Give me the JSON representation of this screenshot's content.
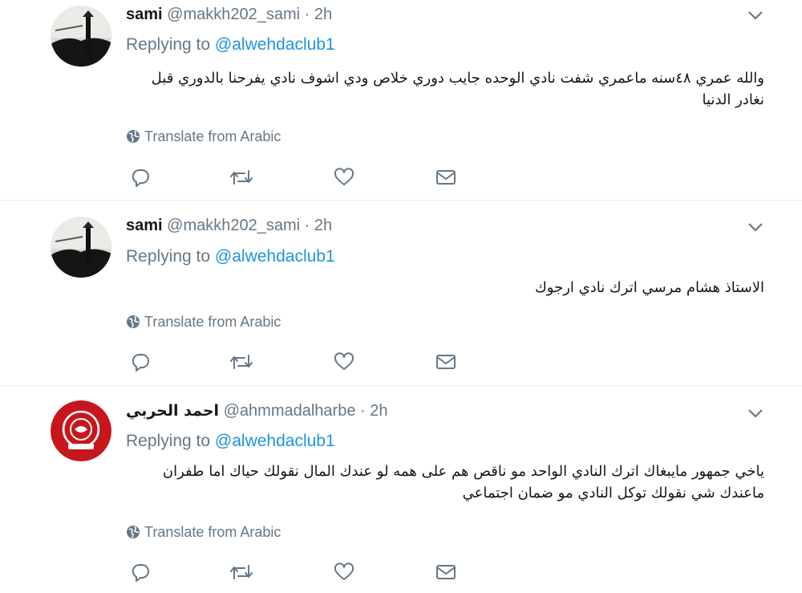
{
  "tweets": [
    {
      "name": "sami",
      "handle": "@makkh202_sami",
      "dot": "·",
      "time": "2h",
      "replying_prefix": "Replying to ",
      "replying_to": "@alwehdaclub1",
      "text": "والله عمري ٤٨سنه ماعمري شفت نادي الوحده جايب دوري خلاص  ودي اشوف نادي يفرحنا بالدوري  قبل نغادر الدنيا",
      "translate": "Translate from Arabic"
    },
    {
      "name": "sami",
      "handle": "@makkh202_sami",
      "dot": "·",
      "time": "2h",
      "replying_prefix": "Replying to ",
      "replying_to": "@alwehdaclub1",
      "text": "الاستاذ هشام مرسي اترك نادي ارجوك",
      "translate": "Translate from Arabic"
    },
    {
      "name": "احمد الحربي",
      "handle": "@ahmmadalharbe",
      "dot": "·",
      "time": "2h",
      "replying_prefix": "Replying to ",
      "replying_to": "@alwehdaclub1",
      "text": "ياخي جمهور مايبغاك اترك النادي الواحد مو ناقص هم  على همه لو عندك المال نقولك حياك اما طفران ماعندك شي نقولك توكل النادي مو ضمان اجتماعي",
      "translate": "Translate from Arabic"
    }
  ],
  "colors": {
    "link": "#1b95e0",
    "muted": "#657786",
    "text": "#14171a",
    "divider": "#e6ecf0",
    "avatar2_red": "#c8161d"
  },
  "icons": [
    "chevron-down-icon",
    "globe-icon",
    "reply-icon",
    "retweet-icon",
    "like-icon",
    "message-icon"
  ]
}
